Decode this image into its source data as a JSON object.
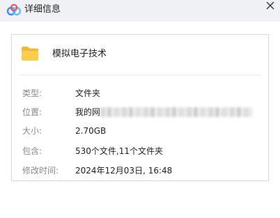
{
  "window": {
    "title": "详细信息",
    "logo_icon": "baidu-netdisk-cloud-icon",
    "close_icon": "close-icon",
    "titlebar_color": "#f0f1f4"
  },
  "file": {
    "name": "模拟电子技术",
    "icon": "folder-icon",
    "icon_color": "#f7c33f"
  },
  "details": {
    "type_label": "类型:",
    "type_value": "文件夹",
    "location_label": "位置:",
    "location_value": "我的网",
    "location_redacted": true,
    "size_label": "大小:",
    "size_value": "2.70GB",
    "contains_label": "包含:",
    "contains_value": "530个文件,11个文件夹",
    "modified_label": "修改时间:",
    "modified_value": "2024年12月03日, 16:48"
  }
}
